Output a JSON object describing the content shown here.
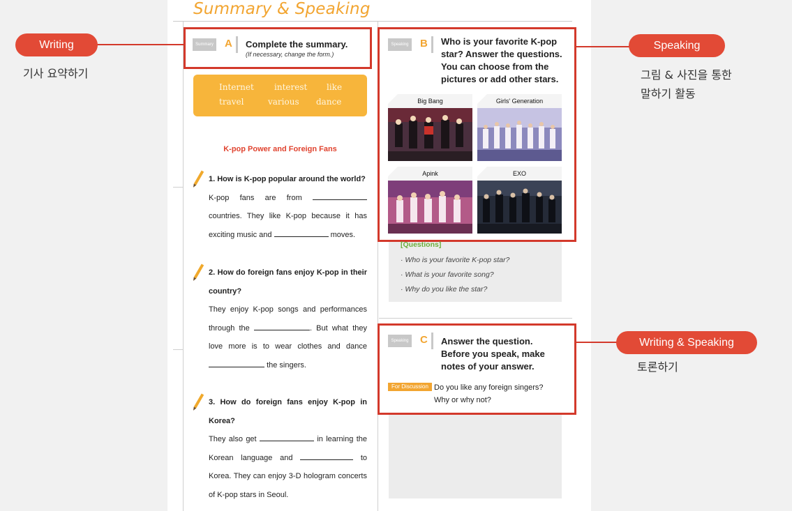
{
  "header": {
    "title": "Summary & Speaking"
  },
  "summary_section": {
    "tag": "Summary",
    "letter": "A",
    "instruction": "Complete the summary.",
    "note": "(If necessary, change the form.)",
    "word_box": [
      "Internet",
      "interest",
      "like",
      "travel",
      "various",
      "dance"
    ],
    "article_title": "K-pop Power and Foreign Fans",
    "questions": [
      {
        "question": "1. How is K-pop popular around the world?",
        "answer_parts": [
          "K-pop fans are from",
          "countries. They like K-pop because it has exciting music and",
          "moves."
        ]
      },
      {
        "question": "2. How do foreign fans enjoy K-pop in their country?",
        "answer_parts": [
          "They enjoy K-pop songs and performances through the",
          ". But what they love more is to wear clothes and dance",
          "the singers."
        ]
      },
      {
        "question": "3. How do foreign fans enjoy K-pop in Korea?",
        "answer_parts": [
          "They also get",
          "in learning the Korean language and",
          "to Korea. They can enjoy 3-D hologram concerts of K-pop stars in Seoul."
        ]
      }
    ]
  },
  "speaking_section_b": {
    "tag": "Speaking",
    "letter": "B",
    "instruction_lines": [
      "Who is your favorite K-pop",
      "star? Answer the questions.",
      "You can choose from the",
      "pictures or add other stars."
    ],
    "stars": [
      {
        "name": "Big Bang",
        "photo_color": "#5a3f4e"
      },
      {
        "name": "Girls' Generation",
        "photo_color": "#8a86b8"
      },
      {
        "name": "Apink",
        "photo_color": "#b65a86"
      },
      {
        "name": "EXO",
        "photo_color": "#2e3442"
      }
    ],
    "questions_heading": "[Questions]",
    "questions": [
      "Who is your favorite K-pop star?",
      "What is your favorite song?",
      "Why do you like the star?"
    ]
  },
  "speaking_section_c": {
    "tag": "Speaking",
    "letter": "C",
    "instruction_lines": [
      "Answer the question.",
      "Before you speak, make",
      "notes of your answer."
    ],
    "discussion_tag": "For Discussion",
    "discussion_lines": [
      "Do you like any foreign singers?",
      "Why or why not?"
    ]
  },
  "side_labels": {
    "writing": {
      "pill": "Writing",
      "korean": "기사 요약하기"
    },
    "speaking": {
      "pill": "Speaking",
      "korean_lines": [
        "그림 & 사진을 통한",
        "말하기 활동"
      ]
    },
    "writing_speaking": {
      "pill": "Writing & Speaking",
      "korean": "토론하기"
    }
  },
  "colors": {
    "accent_orange": "#f2a531",
    "frame_red": "#d3392b",
    "pill_red": "#e24a36",
    "questions_green": "#6cae3c"
  }
}
